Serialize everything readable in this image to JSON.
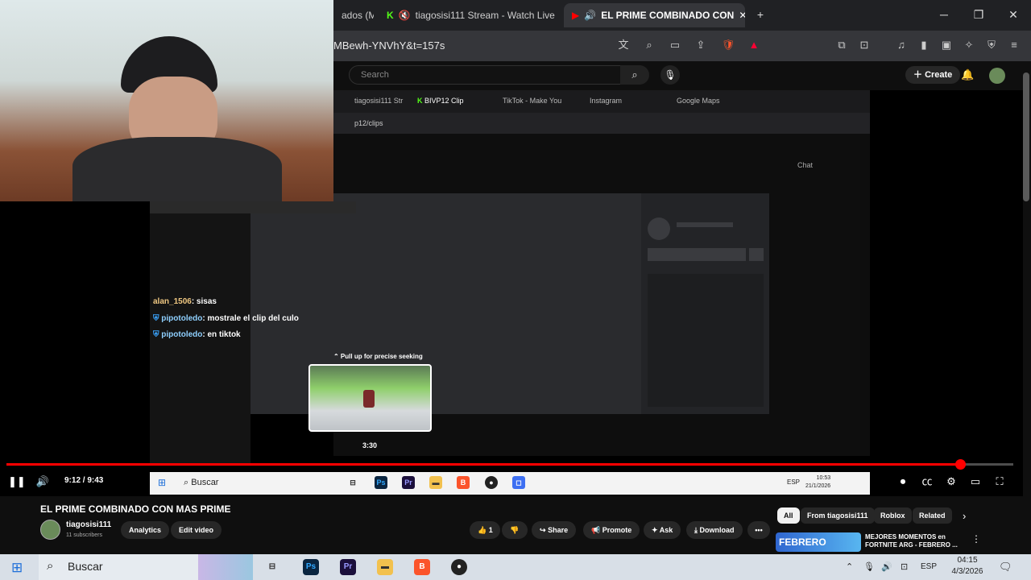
{
  "browser": {
    "tabs": [
      {
        "label": "ados (M"
      },
      {
        "label": "tiagosisi111 Stream - Watch Live"
      },
      {
        "label": "EL PRIME COMBINADO CON"
      }
    ],
    "new_tab": "+",
    "url": "MBewh-YNVhY&t=157s"
  },
  "youtube": {
    "search_placeholder": "Search",
    "create_label": "Create",
    "video_title": "EL PRIME COMBINADO CON MAS PRIME",
    "channel": "tiagosisi111",
    "subscribers": "11 subscribers",
    "analytics": "Analytics",
    "edit_video": "Edit video",
    "likes": "1",
    "share": "Share",
    "promote": "Promote",
    "ask": "Ask",
    "download": "Download",
    "more": "•••",
    "chips": [
      "All",
      "From tiagosisi111",
      "Roblox",
      "Related"
    ],
    "recommended": {
      "thumb_text": "FEBRERO",
      "title": "MEJORES MOMENTOS en FORTNITE ARG - FEBRERO ..."
    }
  },
  "player": {
    "current_time": "9:12 / 9:43",
    "progress_fraction": 0.947,
    "pull_hint": "⌃ Pull up for precise seeking",
    "preview_time": "3:30"
  },
  "inner_browser": {
    "tabs": [
      "tiagosisi111 Str",
      "BIVP12 Clip",
      "TikTok - Make You",
      "Instagram",
      "Google Maps"
    ],
    "url": "p12/clips",
    "chat_label": "Chat"
  },
  "chat": [
    {
      "user": "alan_1506",
      "text": ": sisas"
    },
    {
      "user": "pipotoledo",
      "text": ": mostrale el clip del culo"
    },
    {
      "user": "pipotoledo",
      "text": ": en tiktok"
    }
  ],
  "inner_taskbar": {
    "search": "Buscar",
    "lang": "ESP",
    "time": "10:53",
    "date": "21/1/2026"
  },
  "taskbar": {
    "search": "Buscar",
    "lang": "ESP",
    "time": "04:15",
    "date": "4/3/2026"
  },
  "colors": {
    "accent_red": "#ff0000",
    "yt_bg": "#0f0f0f",
    "chat_user": "#f0c882"
  }
}
